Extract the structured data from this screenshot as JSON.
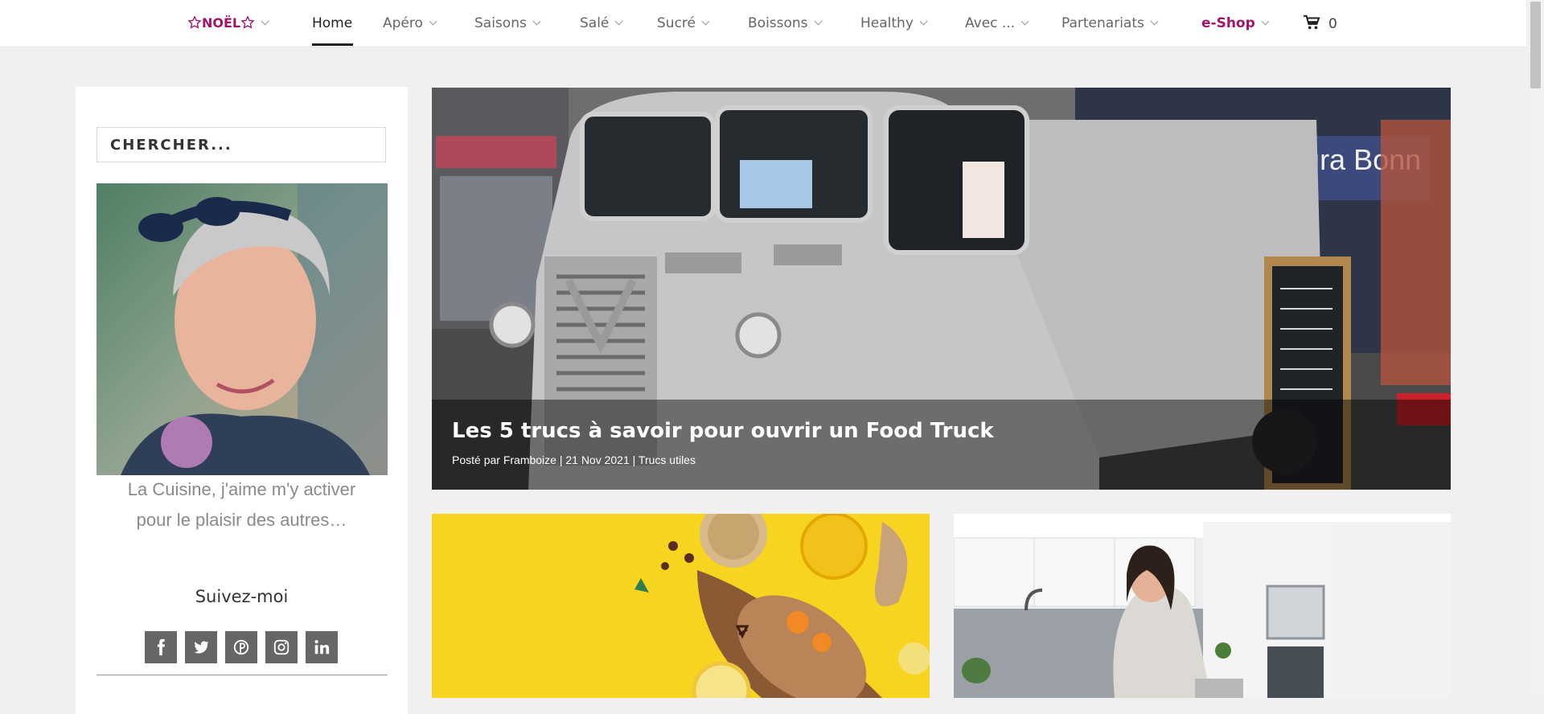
{
  "nav": {
    "items": [
      {
        "label": "NOËL"
      },
      {
        "label": "Home"
      },
      {
        "label": "Apéro"
      },
      {
        "label": "Saisons"
      },
      {
        "label": "Salé"
      },
      {
        "label": "Sucré"
      },
      {
        "label": "Boissons"
      },
      {
        "label": "Healthy"
      },
      {
        "label": "Avec ..."
      },
      {
        "label": "Partenariats"
      },
      {
        "label": "e-Shop"
      }
    ],
    "active": "Home",
    "cart_count": "0",
    "accent_color": "#a0146b"
  },
  "sidebar": {
    "search_placeholder": "CHERCHER...",
    "bio_line1": "La Cuisine, j'aime m'y activer",
    "bio_line2": "pour le plaisir des autres…",
    "follow_title": "Suivez-moi",
    "social": [
      "facebook-icon",
      "twitter-icon",
      "pinterest-icon",
      "instagram-icon",
      "linkedin-icon"
    ]
  },
  "hero": {
    "title": "Les 5 trucs à savoir pour ouvrir un Food Truck",
    "meta": "Posté par Framboize | 21 Nov 2021 | Trucs utiles",
    "sign_text": "Restaura   Bonn"
  }
}
